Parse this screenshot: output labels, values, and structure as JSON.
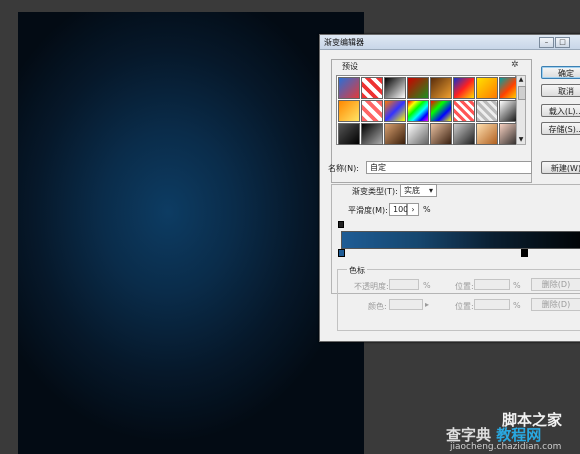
{
  "dialog": {
    "title": "渐变编辑器",
    "presets_label": "预设",
    "buttons": {
      "ok": "确定",
      "cancel": "取消",
      "load": "载入(L)...",
      "save": "存储(S)...",
      "new": "新建(W)"
    },
    "name_label": "名称(N):",
    "name_value": "自定",
    "type_label": "渐变类型(T):",
    "type_value": "实底",
    "smooth_label": "平滑度(M):",
    "smooth_value": "100",
    "smooth_unit": "%",
    "stops_label": "色标",
    "opacity_label": "不透明度:",
    "opacity_unit": "%",
    "position_label": "位置:",
    "position_unit": "%",
    "delete_label": "删除(D)",
    "color_label": "颜色:"
  },
  "preset_swatches": [
    "linear-gradient(135deg,#2b6fd6,#e23a3a)",
    "repeating-linear-gradient(45deg,#e33 0 4px,#fff 4px 8px)",
    "linear-gradient(135deg,#000,#fff)",
    "linear-gradient(135deg,#c00,#1d8f1d)",
    "linear-gradient(135deg,#5a2d0c,#f0a030)",
    "linear-gradient(135deg,#1133cc,#ff2020,#ffdd00)",
    "linear-gradient(135deg,#ffe000,#ff7a00)",
    "linear-gradient(135deg,#00a0a0,#ff4000,#ffee00)",
    "linear-gradient(135deg,#ff8800,#ffe566)",
    "repeating-linear-gradient(45deg,#f66 0 4px,#fff 4px 8px)",
    "linear-gradient(135deg,#ff7700,#3333ff,#ffff00)",
    "linear-gradient(135deg,#f00,#ff0,#0f0,#0ff,#00f,#f0f)",
    "linear-gradient(135deg,#f00,#0f0,#00f,#ff0)",
    "repeating-linear-gradient(45deg,#f55 0 3px,#fff 3px 6px)",
    "repeating-linear-gradient(45deg,#bbb 0 3px,#eee 3px 6px)",
    "linear-gradient(135deg,#fff,#000)",
    "linear-gradient(135deg,#555,#000)",
    "linear-gradient(135deg,#000,#aaa)",
    "linear-gradient(135deg,#d8a070,#3a1e0a)",
    "linear-gradient(135deg,#fff,#666)",
    "linear-gradient(135deg,#e8c0a0,#3a2010)",
    "linear-gradient(135deg,#ccc,#222)",
    "linear-gradient(135deg,#ffe0b0,#b06020)",
    "linear-gradient(135deg,#f6d0c0,#202020)"
  ],
  "watermark": {
    "line1": "脚本之家",
    "line2a": "查字典",
    "line2b": "教程网",
    "line3": "jiaocheng.chazidian.com"
  },
  "colors": {
    "canvas_center": "#0d3c63",
    "gradient_start": "#1e5c95",
    "gradient_end": "#000000",
    "accent": "#29a8e0"
  }
}
